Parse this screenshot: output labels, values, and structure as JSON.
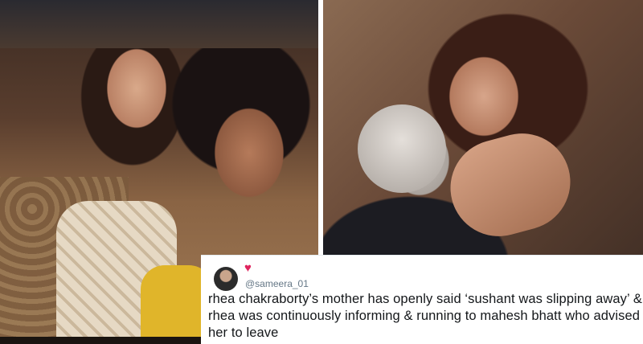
{
  "tweet": {
    "handle": "@sameera_01",
    "heart_icon": "♥",
    "heart_color": "#e0245e",
    "text": "rhea chakraborty’s mother has openly said ‘sushant was slipping away’ & rhea was continuously informing & running to mahesh bhatt who advised her to leave"
  }
}
